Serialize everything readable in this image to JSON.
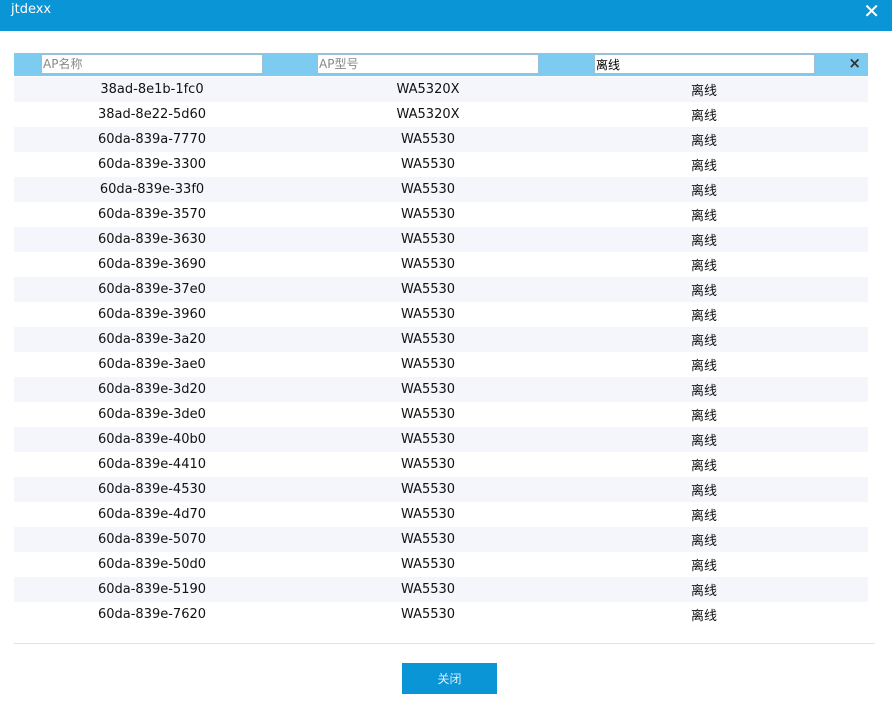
{
  "window": {
    "title": "jtdexx",
    "close_icon": "close-icon"
  },
  "filters": {
    "name_placeholder": "AP名称",
    "name_value": "",
    "model_placeholder": "AP型号",
    "model_value": "",
    "status_placeholder": "",
    "status_value": "离线",
    "clear_icon": "×"
  },
  "table": {
    "rows": [
      {
        "name": "38ad-8e1b-1fc0",
        "model": "WA5320X",
        "status": "离线"
      },
      {
        "name": "38ad-8e22-5d60",
        "model": "WA5320X",
        "status": "离线"
      },
      {
        "name": "60da-839a-7770",
        "model": "WA5530",
        "status": "离线"
      },
      {
        "name": "60da-839e-3300",
        "model": "WA5530",
        "status": "离线"
      },
      {
        "name": "60da-839e-33f0",
        "model": "WA5530",
        "status": "离线"
      },
      {
        "name": "60da-839e-3570",
        "model": "WA5530",
        "status": "离线"
      },
      {
        "name": "60da-839e-3630",
        "model": "WA5530",
        "status": "离线"
      },
      {
        "name": "60da-839e-3690",
        "model": "WA5530",
        "status": "离线"
      },
      {
        "name": "60da-839e-37e0",
        "model": "WA5530",
        "status": "离线"
      },
      {
        "name": "60da-839e-3960",
        "model": "WA5530",
        "status": "离线"
      },
      {
        "name": "60da-839e-3a20",
        "model": "WA5530",
        "status": "离线"
      },
      {
        "name": "60da-839e-3ae0",
        "model": "WA5530",
        "status": "离线"
      },
      {
        "name": "60da-839e-3d20",
        "model": "WA5530",
        "status": "离线"
      },
      {
        "name": "60da-839e-3de0",
        "model": "WA5530",
        "status": "离线"
      },
      {
        "name": "60da-839e-40b0",
        "model": "WA5530",
        "status": "离线"
      },
      {
        "name": "60da-839e-4410",
        "model": "WA5530",
        "status": "离线"
      },
      {
        "name": "60da-839e-4530",
        "model": "WA5530",
        "status": "离线"
      },
      {
        "name": "60da-839e-4d70",
        "model": "WA5530",
        "status": "离线"
      },
      {
        "name": "60da-839e-5070",
        "model": "WA5530",
        "status": "离线"
      },
      {
        "name": "60da-839e-50d0",
        "model": "WA5530",
        "status": "离线"
      },
      {
        "name": "60da-839e-5190",
        "model": "WA5530",
        "status": "离线"
      },
      {
        "name": "60da-839e-7620",
        "model": "WA5530",
        "status": "离线"
      }
    ]
  },
  "footer": {
    "close_button_label": "关闭"
  },
  "colors": {
    "titlebar": "#0a95d6",
    "filter_row": "#7dcbf1",
    "row_alt": "#f5f6fc",
    "button": "#0a95d6"
  }
}
